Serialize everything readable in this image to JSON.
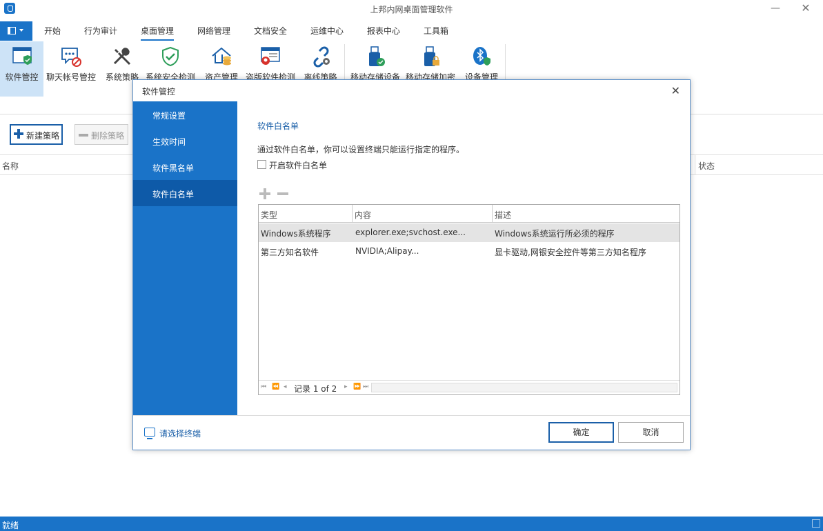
{
  "window": {
    "title": "上邦内网桌面管理软件",
    "minimize_glyph": "—",
    "close_glyph": "✕"
  },
  "menu": {
    "tabs": [
      "开始",
      "行为审计",
      "桌面管理",
      "网络管理",
      "文档安全",
      "运维中心",
      "报表中心",
      "工具箱"
    ],
    "active_tab": "桌面管理"
  },
  "ribbon": {
    "items": [
      {
        "label": "软件管控",
        "icon": "software-control-icon"
      },
      {
        "label": "聊天帐号管控",
        "icon": "chat-account-icon"
      },
      {
        "label": "系统策略",
        "icon": "tools-icon"
      },
      {
        "label": "系统安全检测",
        "icon": "shield-check-icon"
      },
      {
        "label": "资产管理",
        "icon": "asset-house-icon"
      },
      {
        "label": "盗版软件检测",
        "icon": "piracy-detect-icon"
      },
      {
        "label": "离线策略",
        "icon": "offline-link-icon"
      },
      {
        "label": "移动存储设备",
        "icon": "usb-check-icon"
      },
      {
        "label": "移动存储加密",
        "icon": "usb-lock-icon"
      },
      {
        "label": "设备管理",
        "icon": "bluetooth-shield-icon"
      }
    ]
  },
  "toolbar": {
    "new_label": "新建策略",
    "delete_label": "删除策略"
  },
  "list": {
    "columns": [
      "名称",
      "状态"
    ]
  },
  "status_bar": {
    "text": "就绪"
  },
  "dialog": {
    "title": "软件管控",
    "close_glyph": "✕",
    "nav": [
      "常规设置",
      "生效时间",
      "软件黑名单",
      "软件白名单"
    ],
    "active_nav": "软件白名单",
    "section_title": "软件白名单",
    "description": "通过软件白名单，你可以设置终端只能运行指定的程序。",
    "checkbox_label": "开启软件白名单",
    "checkbox_checked": false,
    "grid": {
      "columns": [
        "类型",
        "内容",
        "描述"
      ],
      "rows": [
        {
          "type": "Windows系统程序",
          "content": "explorer.exe;svchost.exe...",
          "desc": "Windows系统运行所必须的程序"
        },
        {
          "type": "第三方知名软件",
          "content": "NVIDIA;Alipay...",
          "desc": "显卡驱动,网银安全控件等第三方知名程序"
        }
      ],
      "pager": "记录 1 of 2",
      "nav_first": "⏮",
      "nav_prev_page": "⏪",
      "nav_prev": "◂",
      "nav_next": "▸",
      "nav_next_page": "⏩",
      "nav_last": "⏭"
    },
    "select_terminal": "请选择终端",
    "ok_label": "确定",
    "cancel_label": "取消"
  }
}
